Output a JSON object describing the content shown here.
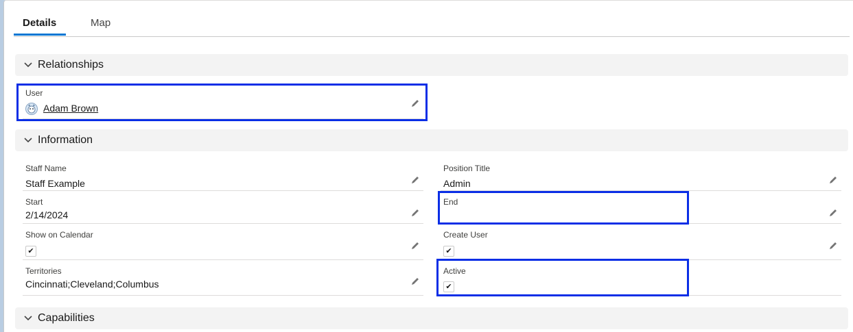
{
  "tabs": [
    {
      "label": "Details",
      "active": true
    },
    {
      "label": "Map",
      "active": false
    }
  ],
  "sections": {
    "relationships": {
      "title": "Relationships"
    },
    "information": {
      "title": "Information"
    },
    "capabilities": {
      "title": "Capabilities"
    }
  },
  "relationships": {
    "user": {
      "label": "User",
      "value": "Adam Brown"
    }
  },
  "information": {
    "staff_name": {
      "label": "Staff Name",
      "value": "Staff Example"
    },
    "position_title": {
      "label": "Position Title",
      "value": "Admin"
    },
    "start": {
      "label": "Start",
      "value": "2/14/2024"
    },
    "end": {
      "label": "End",
      "value": ""
    },
    "show_on_calendar": {
      "label": "Show on Calendar",
      "checked": true
    },
    "create_user": {
      "label": "Create User",
      "checked": true
    },
    "territories": {
      "label": "Territories",
      "value": "Cincinnati;Cleveland;Columbus"
    },
    "active": {
      "label": "Active",
      "checked": true
    }
  },
  "icons": {
    "chevron": "chevron-down-icon",
    "edit": "pencil-icon",
    "avatar": "user-avatar-icon",
    "check": "✔"
  },
  "colors": {
    "accent": "#0176d3",
    "link": "#0b5cab",
    "highlight": "#0a2ee6"
  }
}
